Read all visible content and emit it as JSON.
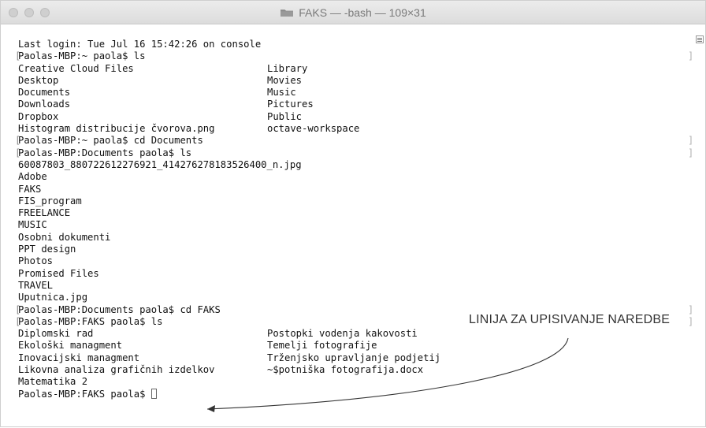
{
  "window": {
    "title": "FAKS — -bash — 109×31"
  },
  "terminal": {
    "lines": [
      {
        "a": "Last login: Tue Jul 16 15:42:26 on console",
        "b": ""
      },
      {
        "a": "Paolas-MBP:~ paola$ ls",
        "b": ""
      },
      {
        "a": "Creative Cloud Files",
        "b": "Library"
      },
      {
        "a": "Desktop",
        "b": "Movies"
      },
      {
        "a": "Documents",
        "b": "Music"
      },
      {
        "a": "Downloads",
        "b": "Pictures"
      },
      {
        "a": "Dropbox",
        "b": "Public"
      },
      {
        "a": "Histogram distribucije čvorova.png",
        "b": "octave-workspace"
      },
      {
        "a": "Paolas-MBP:~ paola$ cd Documents",
        "b": ""
      },
      {
        "a": "Paolas-MBP:Documents paola$ ls",
        "b": ""
      },
      {
        "a": "60087803_880722612276921_414276278183526400_n.jpg",
        "b": ""
      },
      {
        "a": "Adobe",
        "b": ""
      },
      {
        "a": "FAKS",
        "b": ""
      },
      {
        "a": "FIS_program",
        "b": ""
      },
      {
        "a": "FREELANCE",
        "b": ""
      },
      {
        "a": "MUSIC",
        "b": ""
      },
      {
        "a": "Osobni dokumenti",
        "b": ""
      },
      {
        "a": "PPT design",
        "b": ""
      },
      {
        "a": "Photos",
        "b": ""
      },
      {
        "a": "Promised Files",
        "b": ""
      },
      {
        "a": "TRAVEL",
        "b": ""
      },
      {
        "a": "Uputnica.jpg",
        "b": ""
      },
      {
        "a": "Paolas-MBP:Documents paola$ cd FAKS",
        "b": ""
      },
      {
        "a": "Paolas-MBP:FAKS paola$ ls",
        "b": ""
      },
      {
        "a": "Diplomski rad",
        "b": "Postopki vodenja kakovosti"
      },
      {
        "a": "Ekološki managment",
        "b": "Temelji fotografije"
      },
      {
        "a": "Inovacijski managment",
        "b": "Trženjsko upravljanje podjetij"
      },
      {
        "a": "Likovna analiza grafičnih izdelkov",
        "b": "~$potniška fotografija.docx"
      },
      {
        "a": "Matematika 2",
        "b": ""
      },
      {
        "a": "Paolas-MBP:FAKS paola$ ",
        "b": ""
      }
    ]
  },
  "annotation": {
    "text": "LINIJA ZA UPISIVANJE NAREDBE"
  }
}
